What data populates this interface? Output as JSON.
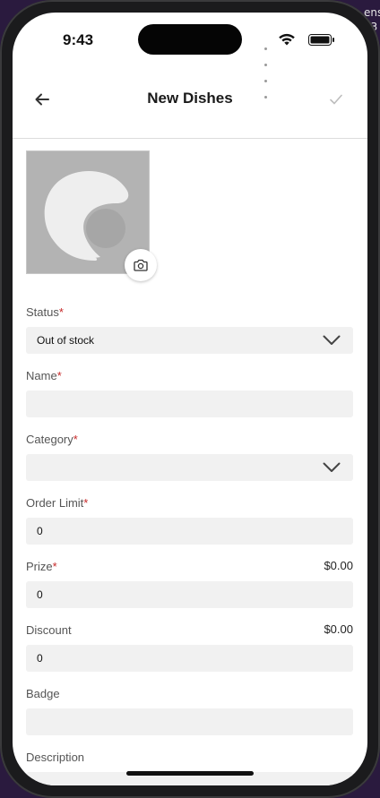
{
  "status_bar": {
    "time": "9:43"
  },
  "background_text": "ens ..3",
  "nav": {
    "title": "New Dishes",
    "back_icon": "arrow-left-icon",
    "save_icon": "check-icon"
  },
  "photo": {
    "placeholder_icon": "image-placeholder-icon",
    "camera_icon": "camera-icon"
  },
  "form": {
    "status": {
      "label": "Status",
      "required_mark": "*",
      "value": "Out of stock"
    },
    "name": {
      "label": "Name",
      "required_mark": "*",
      "value": ""
    },
    "category": {
      "label": "Category",
      "required_mark": "*",
      "value": ""
    },
    "order_limit": {
      "label": "Order Limit",
      "required_mark": "*",
      "value": "0"
    },
    "prize": {
      "label": "Prize",
      "required_mark": "*",
      "amount": "$0.00",
      "value": "0"
    },
    "discount": {
      "label": "Discount",
      "amount": "$0.00",
      "value": "0"
    },
    "badge": {
      "label": "Badge",
      "value": ""
    },
    "description": {
      "label": "Description",
      "value": ""
    }
  },
  "colors": {
    "required": "#c62828",
    "input_bg": "#f1f1f1",
    "photo_bg": "#b3b3b3"
  }
}
